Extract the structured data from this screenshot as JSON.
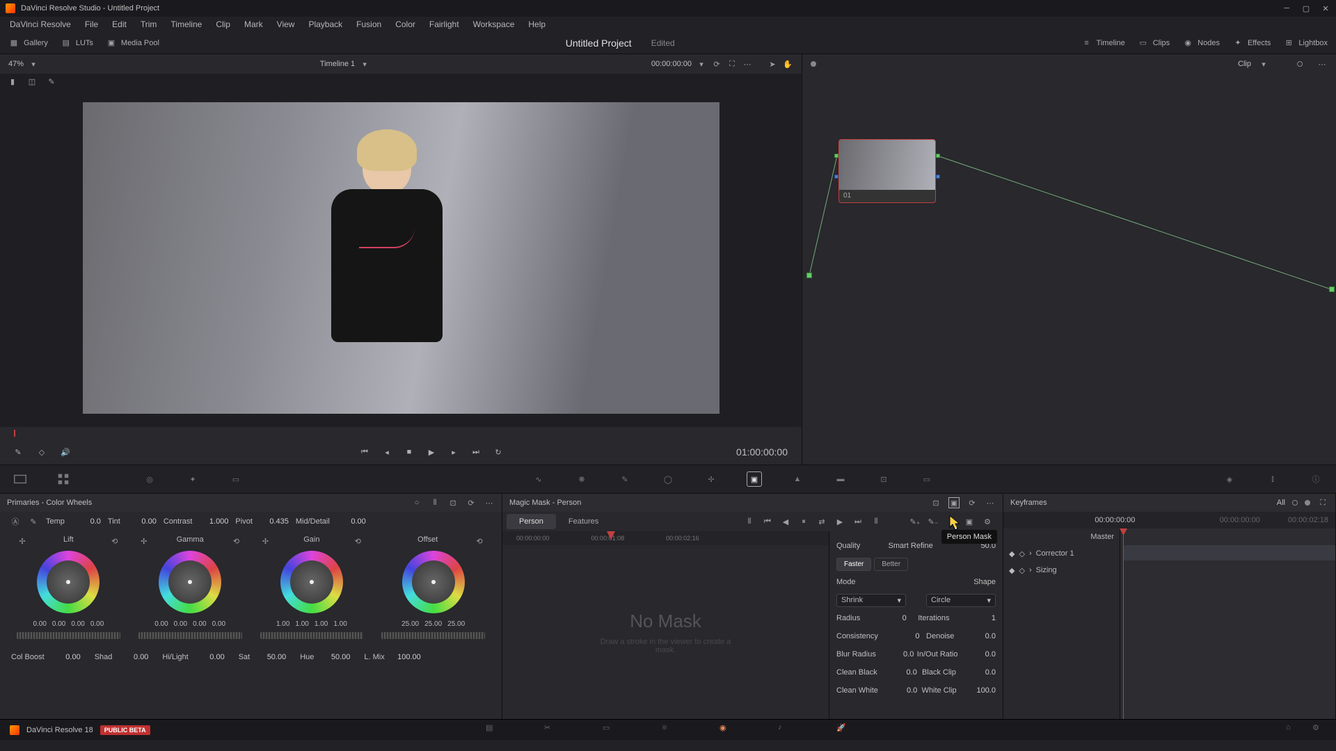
{
  "titlebar": {
    "text": "DaVinci Resolve Studio - Untitled Project"
  },
  "menu": [
    "DaVinci Resolve",
    "File",
    "Edit",
    "Trim",
    "Timeline",
    "Clip",
    "Mark",
    "View",
    "Playback",
    "Fusion",
    "Color",
    "Fairlight",
    "Workspace",
    "Help"
  ],
  "toolbar": {
    "gallery": "Gallery",
    "luts": "LUTs",
    "mediapool": "Media Pool",
    "project": "Untitled Project",
    "edited": "Edited",
    "timeline": "Timeline",
    "clips": "Clips",
    "nodes": "Nodes",
    "effects": "Effects",
    "lightbox": "Lightbox"
  },
  "viewer": {
    "zoom": "47%",
    "timeline_name": "Timeline 1",
    "timecode": "00:00:00:00",
    "clip_label": "Clip",
    "transport_tc": "01:00:00:00"
  },
  "node": {
    "label": "01"
  },
  "primaries": {
    "title": "Primaries - Color Wheels",
    "temp": "Temp",
    "temp_v": "0.0",
    "tint": "Tint",
    "tint_v": "0.00",
    "contrast": "Contrast",
    "contrast_v": "1.000",
    "pivot": "Pivot",
    "pivot_v": "0.435",
    "middetail": "Mid/Detail",
    "middetail_v": "0.00",
    "wheels": {
      "lift": {
        "name": "Lift",
        "vals": [
          "0.00",
          "0.00",
          "0.00",
          "0.00"
        ]
      },
      "gamma": {
        "name": "Gamma",
        "vals": [
          "0.00",
          "0.00",
          "0.00",
          "0.00"
        ]
      },
      "gain": {
        "name": "Gain",
        "vals": [
          "1.00",
          "1.00",
          "1.00",
          "1.00"
        ]
      },
      "offset": {
        "name": "Offset",
        "vals": [
          "25.00",
          "25.00",
          "25.00"
        ]
      }
    },
    "bottom": {
      "colboost": "Col Boost",
      "colboost_v": "0.00",
      "shad": "Shad",
      "shad_v": "0.00",
      "hilight": "Hi/Light",
      "hilight_v": "0.00",
      "sat": "Sat",
      "sat_v": "50.00",
      "hue": "Hue",
      "hue_v": "50.00",
      "lmix": "L. Mix",
      "lmix_v": "100.00"
    }
  },
  "magicmask": {
    "title": "Magic Mask - Person",
    "tab_person": "Person",
    "tab_features": "Features",
    "ruler": [
      "00:00:00:00",
      "00:00:01:08",
      "00:00:02:16"
    ],
    "no_mask": "No Mask",
    "no_mask_sub": "Draw a stroke in the viewer to create a mask.",
    "tooltip": "Person Mask",
    "params": {
      "quality": "Quality",
      "faster": "Faster",
      "better": "Better",
      "smartrefine": "Smart Refine",
      "smartrefine_v": "50.0",
      "mode": "Mode",
      "mode_v": "Shrink",
      "shape": "Shape",
      "shape_v": "Circle",
      "radius": "Radius",
      "radius_v": "0",
      "iterations": "Iterations",
      "iterations_v": "1",
      "consistency": "Consistency",
      "consistency_v": "0",
      "denoise": "Denoise",
      "denoise_v": "0.0",
      "blurradius": "Blur Radius",
      "blurradius_v": "0.0",
      "inout": "In/Out Ratio",
      "inout_v": "0.0",
      "cleanblack": "Clean Black",
      "cleanblack_v": "0.0",
      "blackclip": "Black Clip",
      "blackclip_v": "0.0",
      "cleanwhite": "Clean White",
      "cleanwhite_v": "0.0",
      "whiteclip": "White Clip",
      "whiteclip_v": "100.0"
    }
  },
  "keyframes": {
    "title": "Keyframes",
    "all": "All",
    "tc_start": "00:00:00:00",
    "tc_cur": "00:00:00:00",
    "tc_end": "00:00:02:18",
    "master": "Master",
    "corrector": "Corrector 1",
    "sizing": "Sizing"
  },
  "pagebar": {
    "app": "DaVinci Resolve 18",
    "beta": "PUBLIC BETA"
  }
}
